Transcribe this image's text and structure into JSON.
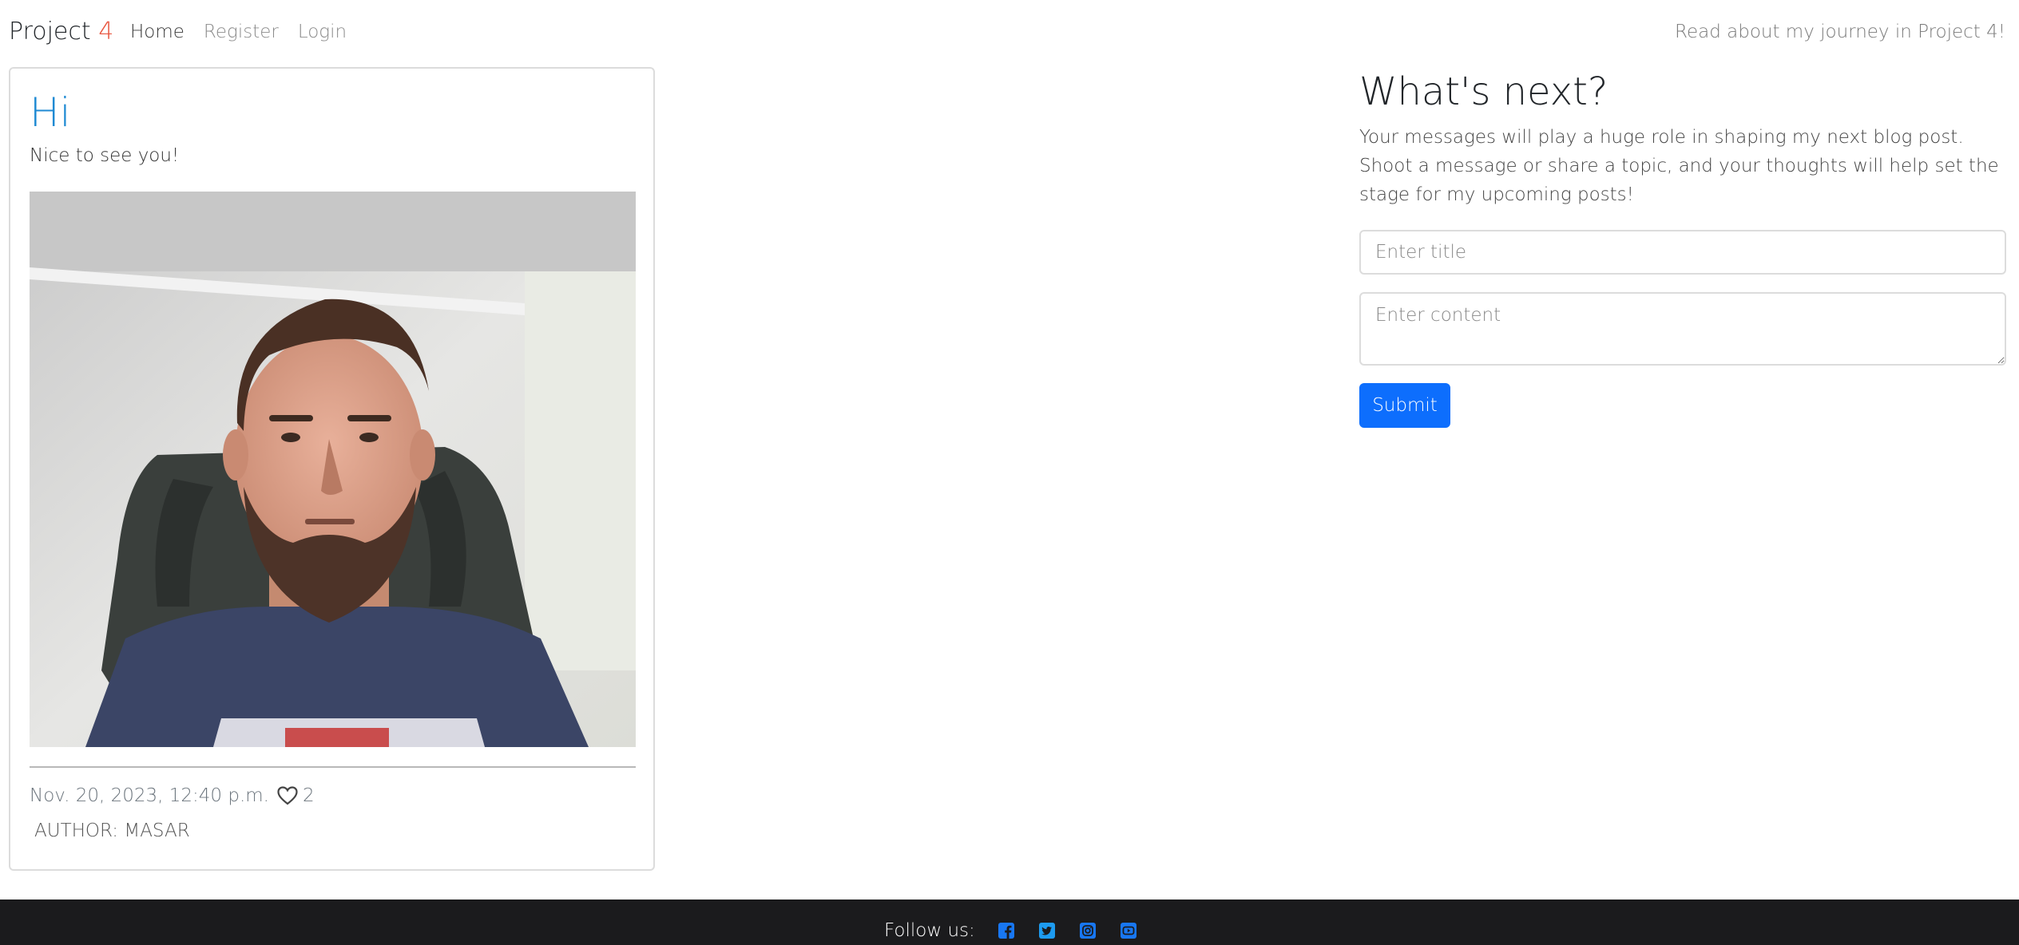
{
  "navbar": {
    "brand_text": "Project ",
    "brand_accent": "4",
    "links": [
      {
        "label": "Home"
      },
      {
        "label": "Register"
      },
      {
        "label": "Login"
      }
    ],
    "right_text": "Read about my journey in Project 4!"
  },
  "post": {
    "title": "Hi",
    "subtitle": "Nice to see you!",
    "date": "Nov. 20, 2023, 12:40 p.m.",
    "likes": "2",
    "author": "AUTHOR: MASAR"
  },
  "panel": {
    "title": "What's next?",
    "text": "Your messages will play a huge role in shaping my next blog post. Shoot a message or share a topic, and your thoughts will help set the stage for my upcoming posts!",
    "title_placeholder": "Enter title",
    "content_placeholder": "Enter content",
    "submit_label": "Submit"
  },
  "footer": {
    "follow_label": "Follow us:",
    "icons": [
      "facebook-icon",
      "twitter-icon",
      "instagram-icon",
      "youtube-icon"
    ]
  },
  "colors": {
    "brand_accent": "#e8553f",
    "title_blue": "#1f8ad3",
    "button_blue": "#0d6efd",
    "footer_bg": "#1b1b1d"
  }
}
